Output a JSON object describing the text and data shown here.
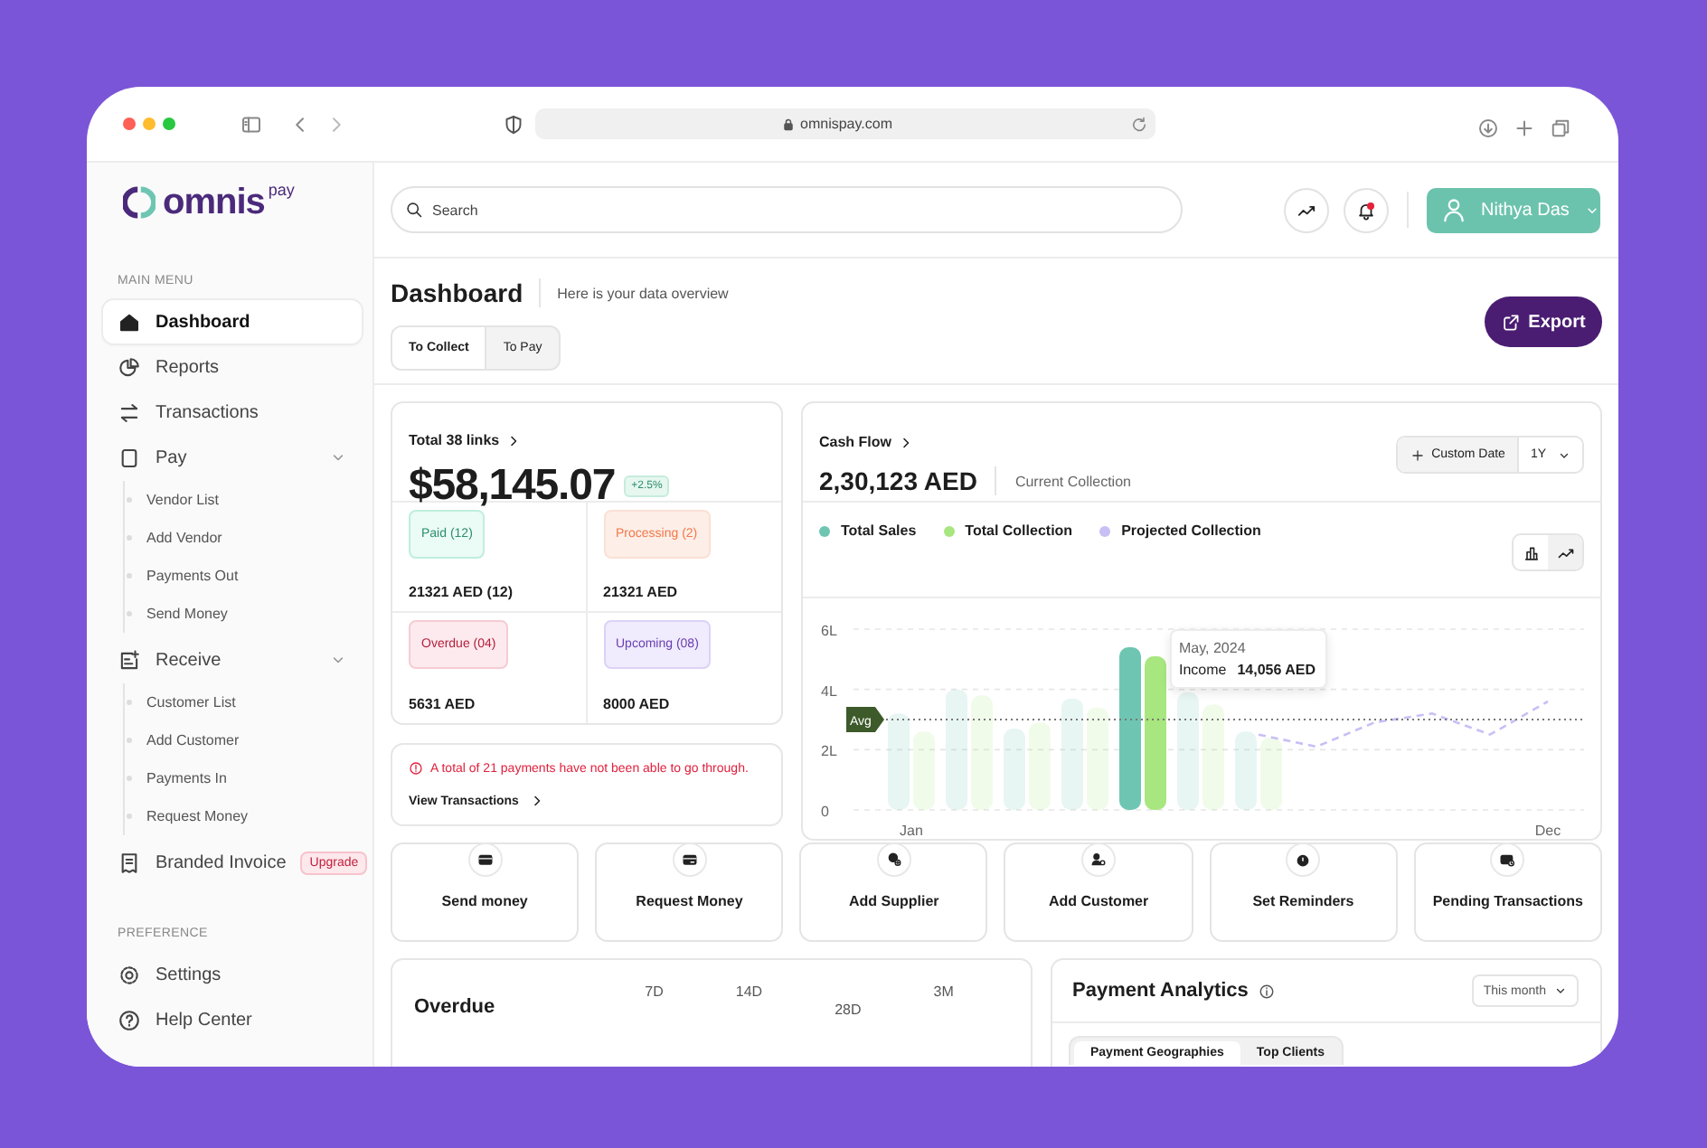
{
  "browser": {
    "url": "omnispay.com"
  },
  "logo": {
    "name": "omnis",
    "suffix": "pay"
  },
  "sidebar": {
    "sections": [
      {
        "heading": "MAIN MENU",
        "items": [
          {
            "label": "Dashboard",
            "kind": "home",
            "selected": true
          },
          {
            "label": "Reports",
            "kind": "pie",
            "selected": false
          },
          {
            "label": "Transactions",
            "kind": "transfer",
            "selected": false
          },
          {
            "label": "Pay",
            "kind": "clipboard",
            "selected": false,
            "expanded": true,
            "children": [
              {
                "label": "Vendor List",
                "selected": false
              },
              {
                "label": "Add Vendor",
                "selected": false
              },
              {
                "label": "Payments Out",
                "selected": false
              },
              {
                "label": "Send Money",
                "selected": false
              }
            ]
          },
          {
            "label": "Receive",
            "kind": "receive",
            "selected": false,
            "expanded": true,
            "children": [
              {
                "label": "Customer List",
                "selected": false
              },
              {
                "label": "Add Customer",
                "selected": false
              },
              {
                "label": "Payments In",
                "selected": false
              },
              {
                "label": "Request Money",
                "selected": false
              }
            ]
          },
          {
            "label": "Branded Invoice",
            "kind": "invoice",
            "selected": false,
            "badge": "Upgrade"
          }
        ]
      },
      {
        "heading": "PREFERENCE",
        "items": [
          {
            "label": "Settings",
            "kind": "gear",
            "selected": false
          },
          {
            "label": "Help Center",
            "kind": "help",
            "selected": false
          }
        ]
      }
    ]
  },
  "topbar": {
    "search": {
      "placeholder": "Search"
    },
    "unread_notifications": true,
    "user": {
      "name": "Nithya Das"
    }
  },
  "header": {
    "title": "Dashboard",
    "subtitle": "Here is your data overview",
    "tabs": [
      {
        "label": "To Collect",
        "selected": true
      },
      {
        "label": "To Pay",
        "selected": false
      }
    ],
    "export": "Export"
  },
  "links_card": {
    "title": "Total 38 links",
    "amount": "$58,145.07",
    "change": "+2.5%",
    "statuses": [
      {
        "kind": "paid",
        "label": "Paid (12)",
        "value": "21321 AED (12)"
      },
      {
        "kind": "processing",
        "label": "Processing (2)",
        "value": "21321 AED"
      },
      {
        "kind": "overdue",
        "label": "Overdue (04)",
        "value": "5631 AED"
      },
      {
        "kind": "upcoming",
        "label": "Upcoming (08)",
        "value": "8000 AED"
      }
    ]
  },
  "alert": {
    "message": "A total of 21 payments have not been able to go through.",
    "link": "View Transactions"
  },
  "cash_flow": {
    "title": "Cash Flow",
    "amount": "2,30,123 AED",
    "caption": "Current Collection",
    "custom_date": "Custom Date",
    "range": "1Y",
    "view_toggle": [
      {
        "kind": "bar",
        "selected": false
      },
      {
        "kind": "line",
        "selected": true
      }
    ],
    "tooltip": {
      "label": "Income",
      "value": "14,056 AED"
    },
    "chart_data": {
      "type": "bar",
      "categories": [
        "Jan",
        null,
        null,
        null,
        null,
        null,
        null,
        null,
        null,
        null,
        null,
        "Dec"
      ],
      "ylim": [
        0,
        6
      ],
      "yticks": [
        {
          "value": 0,
          "label": "0"
        },
        {
          "value": 2,
          "label": "2L"
        },
        {
          "value": 4,
          "label": "4L"
        },
        {
          "value": 6,
          "label": "6L"
        }
      ],
      "series": [
        {
          "name": "Total Sales",
          "color": "#6ec6b2",
          "values": [
            3.2,
            4.0,
            2.7,
            3.7,
            5.4,
            3.9,
            2.6,
            null,
            null,
            null,
            null,
            null
          ]
        },
        {
          "name": "Total Collection",
          "color": "#a8e67f",
          "values": [
            2.6,
            3.8,
            2.9,
            3.4,
            5.1,
            3.5,
            2.4,
            null,
            null,
            null,
            null,
            null
          ]
        },
        {
          "name": "Projected Collection",
          "type": "line",
          "line_style": "dashed",
          "color": "#c8bff5",
          "values": [
            null,
            null,
            null,
            null,
            null,
            null,
            2.5,
            2.1,
            2.9,
            3.2,
            2.5,
            3.6
          ]
        }
      ],
      "ref_lines": [
        {
          "axis": "y",
          "value": 3.0,
          "label": "Avg"
        }
      ],
      "annotations": [
        "May, 2024"
      ]
    }
  },
  "quick_actions": [
    {
      "label": "Send money",
      "kind": "card"
    },
    {
      "label": "Request Money",
      "kind": "card-in"
    },
    {
      "label": "Add Supplier",
      "kind": "supplier"
    },
    {
      "label": "Add Customer",
      "kind": "customer"
    },
    {
      "label": "Set Reminders",
      "kind": "reminder"
    },
    {
      "label": "Pending Transactions",
      "kind": "pending"
    }
  ],
  "overdue": {
    "title": "Overdue",
    "periods": [
      "7D",
      "14D",
      "28D",
      "3M"
    ]
  },
  "payment_analytics": {
    "title": "Payment Analytics",
    "period": "This month",
    "tabs": [
      {
        "label": "Payment Geographies",
        "selected": true
      },
      {
        "label": "Top Clients",
        "selected": false
      }
    ]
  }
}
